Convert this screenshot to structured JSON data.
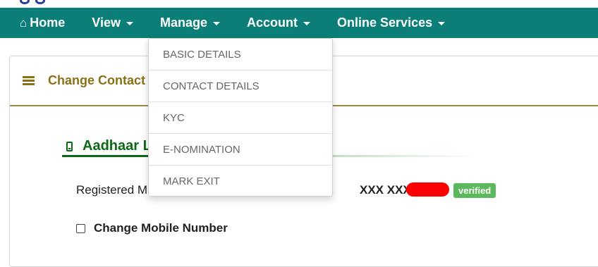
{
  "nav": {
    "home_icon": "home-icon",
    "items": [
      {
        "label": "Home"
      },
      {
        "label": "View"
      },
      {
        "label": "Manage"
      },
      {
        "label": "Account"
      },
      {
        "label": "Online Services"
      }
    ]
  },
  "panel": {
    "title": "Change Contact",
    "menu_icon": "hamburger-icon"
  },
  "section": {
    "title": "Aadhaar L",
    "icon": "mobile-icon"
  },
  "registered": {
    "label": "Registered M",
    "value": "XXX XXX",
    "status": "verified"
  },
  "change_mobile": {
    "label": "Change Mobile Number",
    "checked": false
  },
  "manage_menu": {
    "items": [
      "BASIC DETAILS",
      "CONTACT DETAILS",
      "KYC",
      "E-NOMINATION",
      "MARK EXIT"
    ]
  },
  "colors": {
    "navbar": "#0b7e78",
    "panel_title": "#8a7214",
    "section_title": "#0a6b14",
    "verified_badge": "#5cb85c",
    "redaction": "#ff0000"
  }
}
